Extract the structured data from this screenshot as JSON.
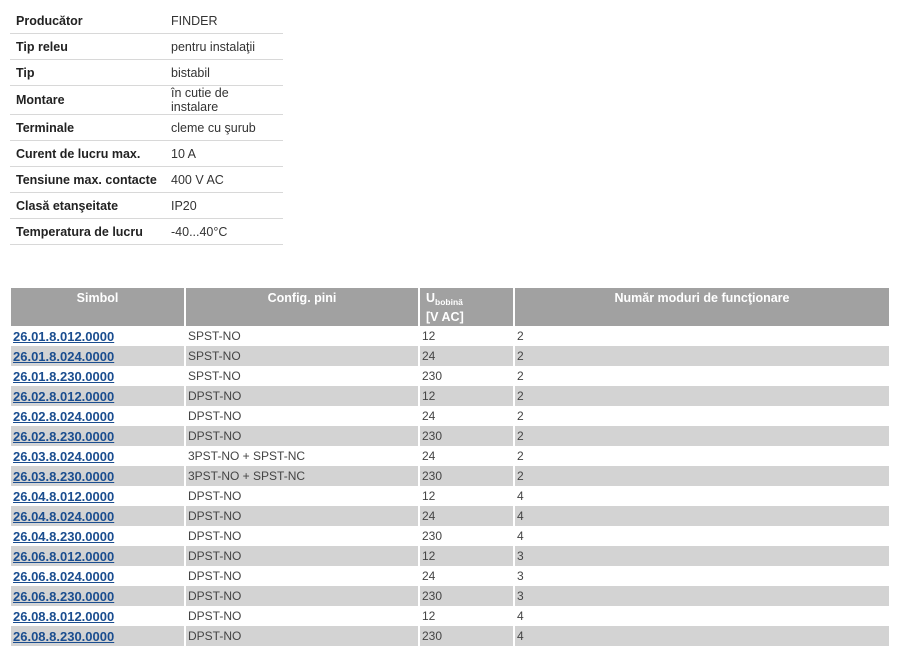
{
  "specs": [
    {
      "label": "Producător",
      "value": "FINDER"
    },
    {
      "label": "Tip releu",
      "value": "pentru instalaţii"
    },
    {
      "label": "Tip",
      "value": "bistabil"
    },
    {
      "label": "Montare",
      "value": "în cutie de instalare"
    },
    {
      "label": "Terminale",
      "value": "cleme cu şurub"
    },
    {
      "label": "Curent de lucru max.",
      "value": "10 A"
    },
    {
      "label": "Tensiune max. contacte",
      "value": "400 V AC"
    },
    {
      "label": "Clasă etanşeitate",
      "value": "IP20"
    },
    {
      "label": "Temperatura de lucru",
      "value": "-40...40°C"
    }
  ],
  "products": {
    "headers": {
      "symbol": "Simbol",
      "config": "Config. pini",
      "voltage_main": "U",
      "voltage_sub": "bobină",
      "voltage_unit": "[V AC]",
      "modes": "Număr moduri de funcţionare"
    },
    "rows": [
      {
        "symbol": "26.01.8.012.0000",
        "config": "SPST-NO",
        "voltage": "12",
        "modes": "2"
      },
      {
        "symbol": "26.01.8.024.0000",
        "config": "SPST-NO",
        "voltage": "24",
        "modes": "2"
      },
      {
        "symbol": "26.01.8.230.0000",
        "config": "SPST-NO",
        "voltage": "230",
        "modes": "2"
      },
      {
        "symbol": "26.02.8.012.0000",
        "config": "DPST-NO",
        "voltage": "12",
        "modes": "2"
      },
      {
        "symbol": "26.02.8.024.0000",
        "config": "DPST-NO",
        "voltage": "24",
        "modes": "2"
      },
      {
        "symbol": "26.02.8.230.0000",
        "config": "DPST-NO",
        "voltage": "230",
        "modes": "2"
      },
      {
        "symbol": "26.03.8.024.0000",
        "config": "3PST-NO + SPST-NC",
        "voltage": "24",
        "modes": "2"
      },
      {
        "symbol": "26.03.8.230.0000",
        "config": "3PST-NO + SPST-NC",
        "voltage": "230",
        "modes": "2"
      },
      {
        "symbol": "26.04.8.012.0000",
        "config": "DPST-NO",
        "voltage": "12",
        "modes": "4"
      },
      {
        "symbol": "26.04.8.024.0000",
        "config": "DPST-NO",
        "voltage": "24",
        "modes": "4"
      },
      {
        "symbol": "26.04.8.230.0000",
        "config": "DPST-NO",
        "voltage": "230",
        "modes": "4"
      },
      {
        "symbol": "26.06.8.012.0000",
        "config": "DPST-NO",
        "voltage": "12",
        "modes": "3"
      },
      {
        "symbol": "26.06.8.024.0000",
        "config": "DPST-NO",
        "voltage": "24",
        "modes": "3"
      },
      {
        "symbol": "26.06.8.230.0000",
        "config": "DPST-NO",
        "voltage": "230",
        "modes": "3"
      },
      {
        "symbol": "26.08.8.012.0000",
        "config": "DPST-NO",
        "voltage": "12",
        "modes": "4"
      },
      {
        "symbol": "26.08.8.230.0000",
        "config": "DPST-NO",
        "voltage": "230",
        "modes": "4"
      }
    ]
  }
}
